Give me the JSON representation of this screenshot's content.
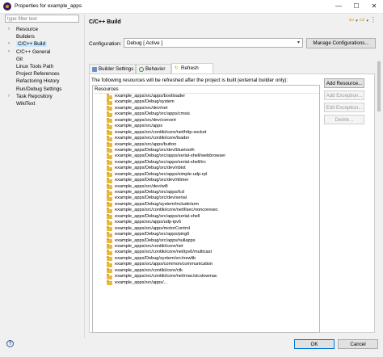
{
  "window": {
    "title": "Properties for example_apps",
    "minimize": "—",
    "maximize": "☐",
    "close": "✕"
  },
  "sidebar": {
    "filter_placeholder": "type filter text",
    "items": [
      {
        "label": "Resource",
        "expandable": true
      },
      {
        "label": "Builders",
        "expandable": false
      },
      {
        "label": "C/C++ Build",
        "expandable": true,
        "selected": true
      },
      {
        "label": "C/C++ General",
        "expandable": true
      },
      {
        "label": "Git",
        "expandable": false
      },
      {
        "label": "Linux Tools Path",
        "expandable": false
      },
      {
        "label": "Project References",
        "expandable": false
      },
      {
        "label": "Refactoring History",
        "expandable": false
      },
      {
        "label": "Run/Debug Settings",
        "expandable": false
      },
      {
        "label": "Task Repository",
        "expandable": true
      },
      {
        "label": "WikiText",
        "expandable": false
      }
    ]
  },
  "page": {
    "title": "C/C++ Build",
    "configuration_label": "Configuration:",
    "configuration_value": "Debug  [ Active ]",
    "manage_button": "Manage Configurations...",
    "tabs": [
      {
        "label": "Builder Settings",
        "active": false
      },
      {
        "label": "Behavior",
        "active": false
      },
      {
        "label": "Refresh Policy",
        "active": true
      }
    ],
    "description": "The following resources will be refreshed after the project is built (external builder only):",
    "resources_header": "Resources",
    "resources": [
      "example_apps/src/apps/bootloader",
      "example_apps/Debug/system",
      "example_apps/src/dev/net",
      "example_apps/Debug/src/apps/cmsis",
      "example_apps/src/dev/convert",
      "example_apps/src/apps",
      "example_apps/src/contiki/core/net/http-socket",
      "example_apps/src/contiki/core/loader",
      "example_apps/src/apps/button",
      "example_apps/Debug/src/dev/bluetooth",
      "example_apps/Debug/src/apps/serial-shell/webbrowser",
      "example_apps/Debug/src/apps/serial-shell/irc",
      "example_apps/Debug/src/dev/nbiot",
      "example_apps/Debug/src/apps/simple-udp-rpl",
      "example_apps/Debug/src/dev/rttimer",
      "example_apps/src/dev/wifi",
      "example_apps/Debug/src/apps/lcd",
      "example_apps/Debug/src/dev/serial",
      "example_apps/Debug/system/include/arm",
      "example_apps/src/contiki/core/net/llsec/noncoresec",
      "example_apps/Debug/src/apps/serial-shell",
      "example_apps/src/apps/udp-ipv6",
      "example_apps/src/apps/motorControl",
      "example_apps/Debug/src/apps/ping6",
      "example_apps/Debug/src/apps/nullapps",
      "example_apps/src/contiki/core/net",
      "example_apps/src/contiki/core/net/ipv6/multicast",
      "example_apps/Debug/system/src/newlib",
      "example_apps/src/apps/common/communication",
      "example_apps/src/contiki/core/ctk",
      "example_apps/src/contiki/core/net/mac/sicslowmac",
      "example_apps/src/apps/..."
    ],
    "buttons": {
      "add": "Add Resource...",
      "add_exception": "Add Exception...",
      "edit_exception": "Edit Exception...",
      "delete": "Delete..."
    }
  },
  "footer": {
    "ok": "OK",
    "cancel": "Cancel"
  },
  "icons": {
    "app": "eclipse-icon",
    "back": "back-arrow-icon",
    "forward": "forward-arrow-icon",
    "menu": "view-menu-icon",
    "help": "help-icon"
  },
  "colors": {
    "selection": "#cde8ff",
    "folder": "#e8b93c",
    "window_bg": "#f0f0f0"
  }
}
